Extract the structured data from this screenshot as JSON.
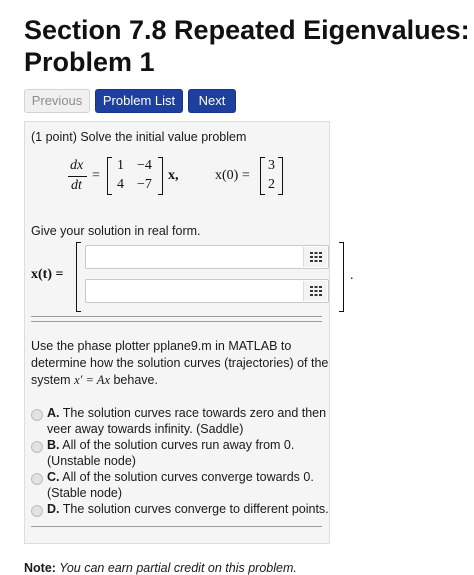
{
  "header": {
    "title_line1": "Section 7.8 Repeated Eigenvalues:",
    "title_line2": "Problem 1"
  },
  "nav": {
    "previous": "Previous",
    "problem_list": "Problem List",
    "next": "Next"
  },
  "problem": {
    "intro": "(1 point) Solve the initial value problem",
    "lhs_num": "dx",
    "lhs_den": "dt",
    "eq": "=",
    "matrix": [
      "1",
      "−4",
      "4",
      "−7"
    ],
    "x_suffix": "x,",
    "ic_lhs": "x(0) =",
    "ic_vector": [
      "3",
      "2"
    ],
    "real_form_prompt": "Give your solution in real form.",
    "xt_label": "x(t) =",
    "period": "."
  },
  "phase": {
    "line1": "Use the phase plotter pplane9.m in MATLAB to",
    "line2": "determine how the solution curves (trajectories) of the",
    "line3_prefix": "system ",
    "line3_math": "x′ = Ax",
    "line3_suffix": " behave."
  },
  "options": [
    {
      "letter": "A.",
      "line1": "The solution curves race towards zero and then",
      "line2": "veer away towards infinity. (Saddle)"
    },
    {
      "letter": "B.",
      "line1": "All of the solution curves run away from 0.",
      "line2": "(Unstable node)"
    },
    {
      "letter": "C.",
      "line1": "All of the solution curves converge towards 0.",
      "line2": "(Stable node)"
    },
    {
      "letter": "D.",
      "line1": "The solution curves converge to different points.",
      "line2": ""
    }
  ],
  "footer": {
    "note_label": "Note:",
    "note_text": " You can earn partial credit on this problem."
  },
  "icons": {
    "matrix_entry": "grid-icon"
  }
}
